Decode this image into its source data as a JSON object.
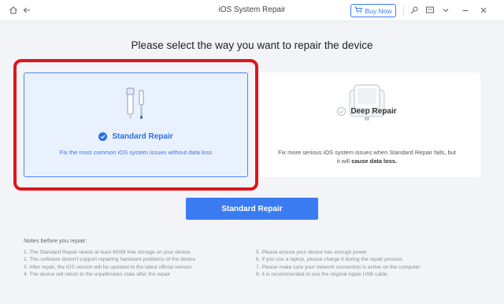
{
  "window": {
    "title": "iOS System Repair",
    "buy_now_label": "Buy Now",
    "icons": [
      "home-icon",
      "back-arrow-icon",
      "cart-icon",
      "search-key-icon",
      "feedback-icon",
      "menu-chevron-icon",
      "minimize-icon",
      "close-icon"
    ]
  },
  "main": {
    "heading": "Please select the way you want to repair the device",
    "options": [
      {
        "title": "Standard Repair",
        "description": "Fix the most common iOS system issues without data loss",
        "selected": true
      },
      {
        "title": "Deep Repair",
        "description_plain": "Fix more serious iOS system issues when Standard Repair fails, but it will ",
        "description_bold": "cause data loss.",
        "selected": false
      }
    ],
    "action_button": "Standard Repair"
  },
  "notes": {
    "title": "Notes before you repair:",
    "left": [
      "1.  The Standard Repair needs at least 800M free storage on your device",
      "2.  This software doesn't support repairing hardware problems of the device",
      "3.  After repair, the iOS version will be updated to the latest official verison.",
      "4.  The device will return to the unjailbroken state after the repair"
    ],
    "right": [
      "5.  Please ensure your device has enough power",
      "6.  If you use a laptop, please charge it during the repair process",
      "7.  Please make sure your network connection is active on the computer",
      "8.  It is recommended to use the original Apple USB cable"
    ]
  },
  "colors": {
    "accent": "#3a7bf2",
    "highlight_frame": "#e0141c",
    "selected_card_bg": "#eaf1fe"
  }
}
